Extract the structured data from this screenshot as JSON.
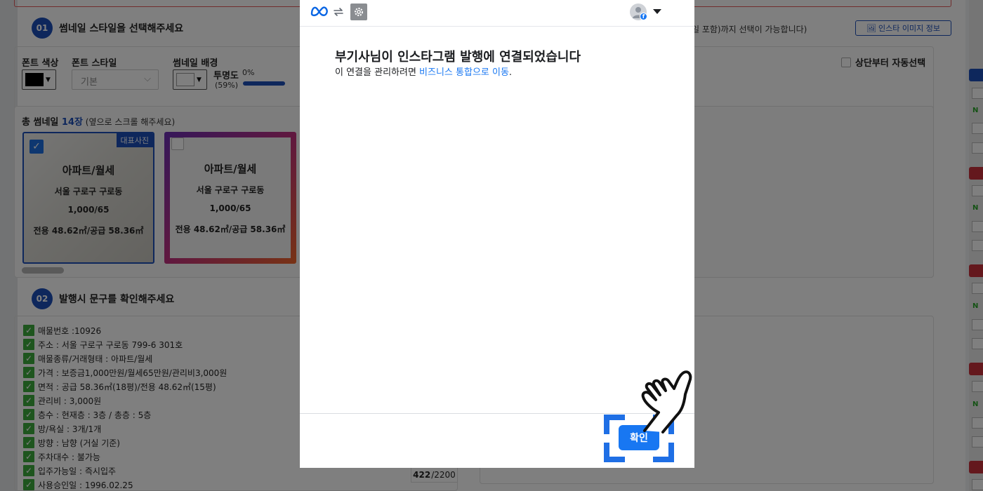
{
  "background": {
    "step1": {
      "num": "01",
      "title": "썸네일 스타일을 선택해주세요"
    },
    "hint_right": "일 포함)까지 선택이 가능합니다)",
    "insta_info_button": "인스타 이미지 정보",
    "font_color_label": "폰트 색상",
    "font_style_label": "폰트 스타일",
    "font_style_value": "기본",
    "thumb_bg_label": "썸네일 배경",
    "opacity_label": "투명도",
    "opacity_value": "(59%)",
    "opacity_min": "0%",
    "auto_select_label": "상단부터 자동선택",
    "thumbs": {
      "title_prefix": "총 썸네일 ",
      "count": "14장",
      "hint": " (옆으로 스크롤 해주세요)",
      "badge": "대표사진",
      "items": [
        {
          "type": "아파트/월세",
          "addr": "서울 구로구 구로동",
          "price": "1,000/65",
          "area": "전용 48.62㎡/공급 58.36㎡"
        },
        {
          "type": "아파트/월세",
          "addr": "서울 구로구 구로동",
          "price": "1,000/65",
          "area": "전용 48.62㎡/공급 58.36㎡"
        }
      ]
    },
    "step2": {
      "num": "02",
      "title": "발행시 문구를 확인해주세요"
    },
    "desc_items": [
      "매물번호 :10926",
      "주소 : 서울 구로구 구로동 799-6 301호",
      "매물종류/거래형태 : 아파트/월세",
      "가격 : 보증금1,000만원/월세65만원/관리비3,000원",
      "면적 : 공급 58.36㎡(18평)/전용 48.62㎡(15평)",
      "관리비 : 3,000원",
      "층수 : 현재층 : 3층 / 총층 : 5층",
      "방/욕실 : 3개/1개",
      "방향 : 남향 (거실 기준)",
      "주차대수 : 불가능",
      "입주가능일 : 즉시입주",
      "사용승인일 : 1996.02.25"
    ],
    "char_count_current": "422",
    "char_count_max": "/2200",
    "right_side_n": "N"
  },
  "modal": {
    "title": "부기사님이 인스타그램 발행에 연결되었습니다",
    "sub_prefix": "이 연결을 관리하려면 ",
    "sub_link": "비즈니스 통합으로 이동",
    "sub_suffix": ".",
    "confirm_button": "확인",
    "fb_badge": "f"
  },
  "colors": {
    "accent": "#1d4fb8",
    "meta_blue": "#1877f2",
    "check_green": "#3cab3c",
    "highlight": "#1f6fe5"
  }
}
